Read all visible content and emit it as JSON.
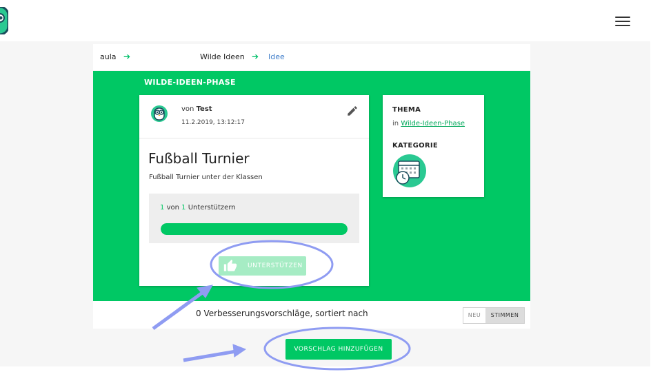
{
  "header": {
    "menu_icon": "hamburger-menu-icon",
    "logo_icon": "aula-owl-logo-icon"
  },
  "breadcrumb": {
    "items": [
      "aula",
      "Wilde Ideen",
      "Idee"
    ],
    "separator_icon": "arrow-right-icon"
  },
  "phase": {
    "title": "WILDE-IDEEN-PHASE",
    "color": "#00c864"
  },
  "idea": {
    "author_prefix": "von",
    "author": "Test",
    "date": "11.2.2019, 13:12:17",
    "title": "Fußball Turnier",
    "description": "Fußball Turnier unter der Klassen",
    "support": {
      "count": "1",
      "of_label": "von",
      "total": "1",
      "label": "Unterstützern",
      "progress_fraction": 1.0
    },
    "support_button": "UNTERSTÜTZEN",
    "edit_icon": "pencil-edit-icon",
    "thumb_icon": "thumbs-up-icon"
  },
  "sidebar": {
    "thema_heading": "THEMA",
    "thema_prefix": "in",
    "thema_link": "Wilde-Ideen-Phase",
    "kategorie_heading": "KATEGORIE",
    "kategorie_icon": "calendar-clock-icon"
  },
  "suggestions": {
    "text": "0 Verbesserungsvorschläge, sortiert nach",
    "sort_options": [
      "NEU",
      "STIMMEN"
    ],
    "active_sort": "STIMMEN",
    "add_button": "VORSCHLAG HINZUFÜGEN"
  }
}
